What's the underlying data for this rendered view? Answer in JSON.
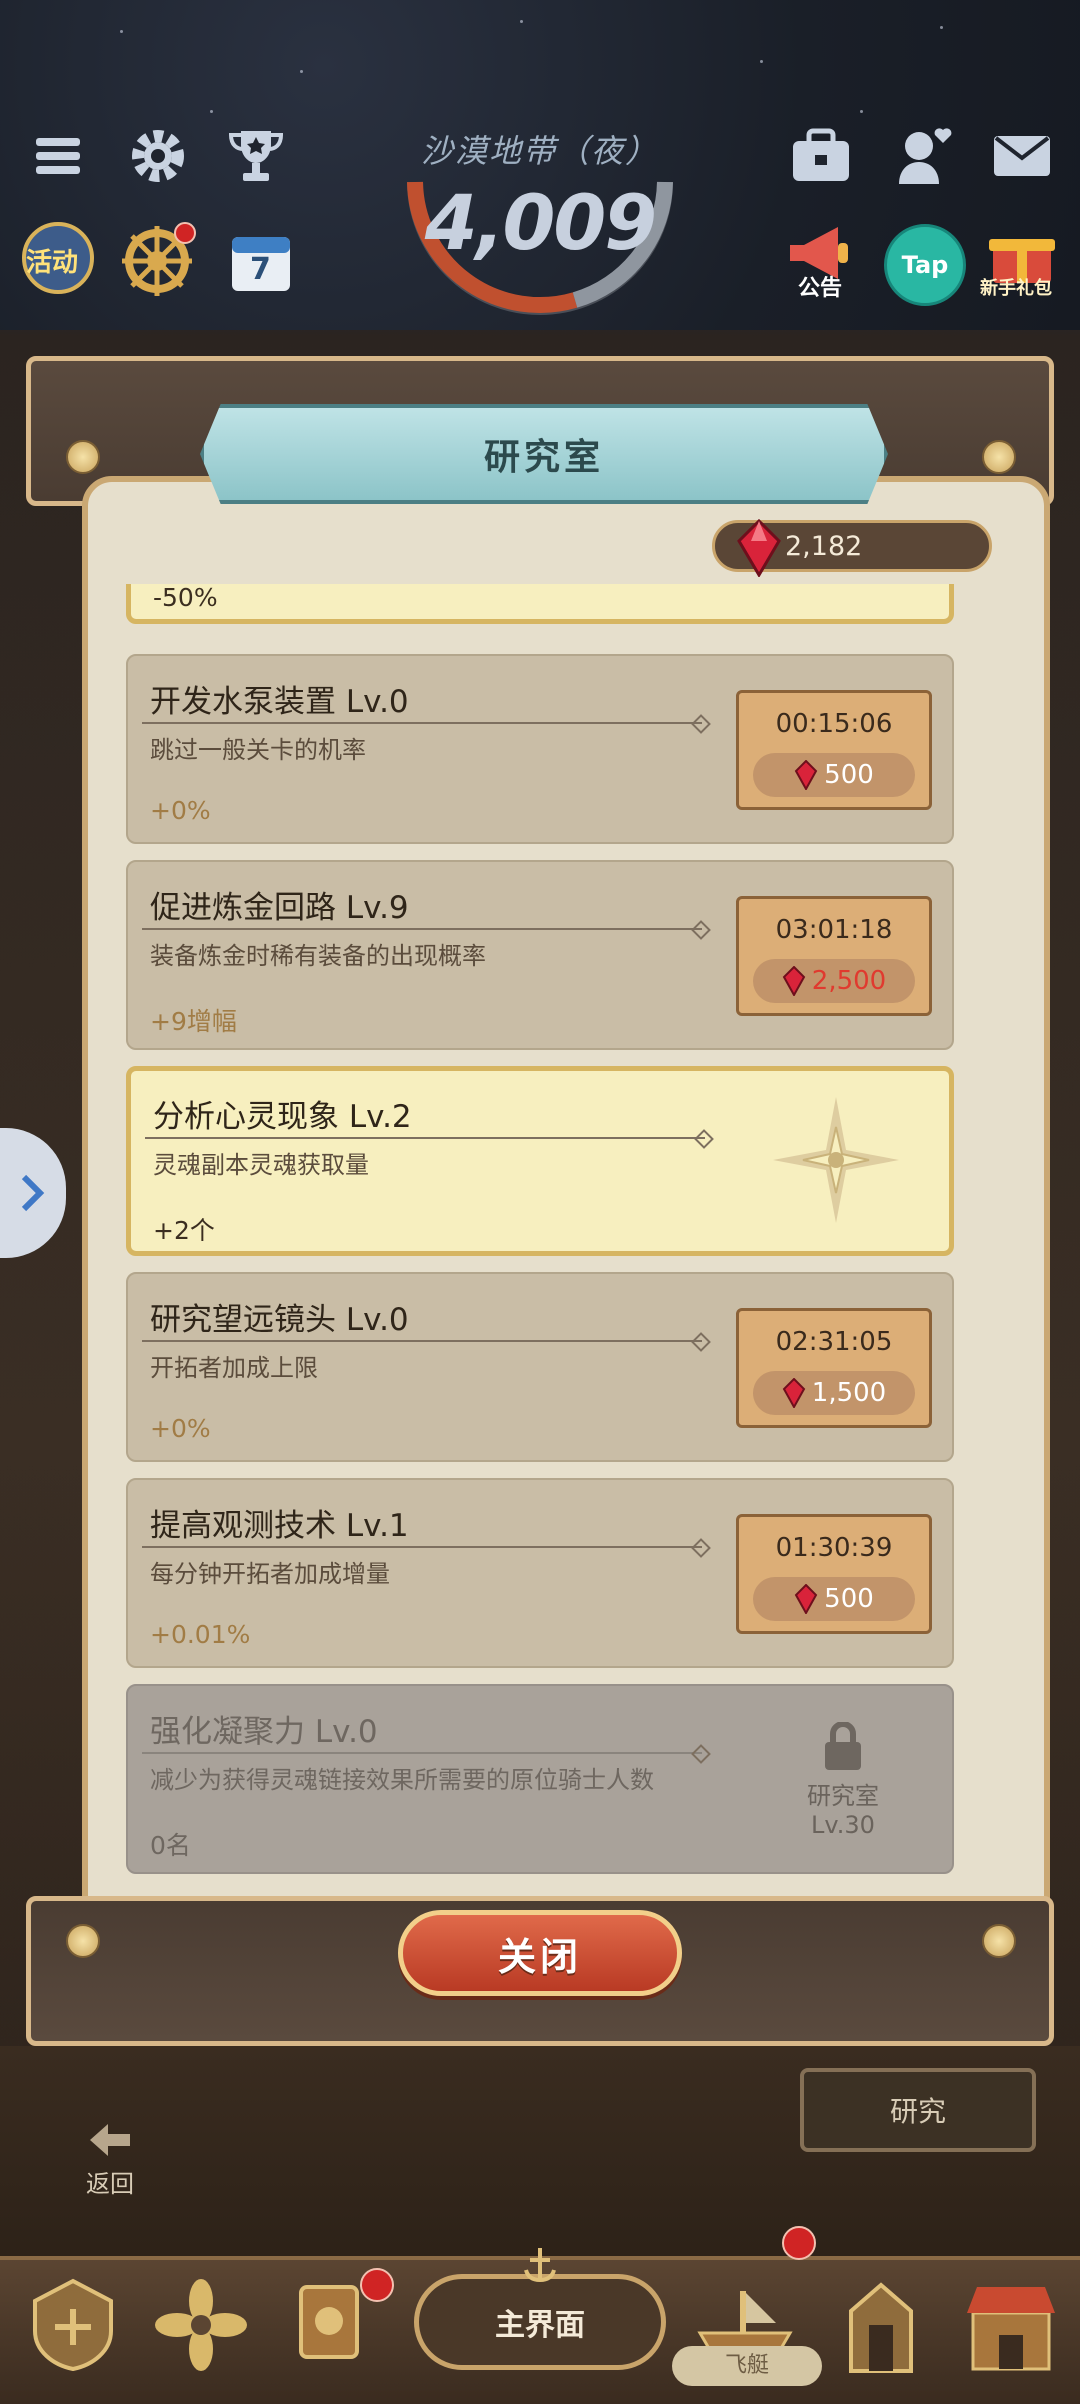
{
  "hud": {
    "area_name": "沙漠地带（夜）",
    "score": "4,009",
    "events_label": "活动",
    "calendar_day": "7",
    "notice_label": "公告",
    "tap_label": "Tap",
    "newbie_label": "新手礼包"
  },
  "panel": {
    "title": "研究室",
    "gem_amount": "2,182",
    "partial_item_effect": "-50%",
    "items": [
      {
        "name": "开发水泵装置 Lv.0",
        "desc": "跳过一般关卡的机率",
        "effect": "+0%",
        "timer": "00:15:06",
        "cost": "500",
        "cost_color": "#ffffff"
      },
      {
        "name": "促进炼金回路 Lv.9",
        "desc": "装备炼金时稀有装备的出现概率",
        "effect": "+9增幅",
        "timer": "03:01:18",
        "cost": "2,500",
        "cost_color": "#e03a2f"
      },
      {
        "name": "分析心灵现象 Lv.2",
        "desc": "灵魂副本灵魂获取量",
        "effect": "+2个"
      },
      {
        "name": "研究望远镜头 Lv.0",
        "desc": "开拓者加成上限",
        "effect": "+0%",
        "timer": "02:31:05",
        "cost": "1,500",
        "cost_color": "#ffffff"
      },
      {
        "name": "提高观测技术 Lv.1",
        "desc": "每分钟开拓者加成增量",
        "effect": "+0.01%",
        "timer": "01:30:39",
        "cost": "500",
        "cost_color": "#ffffff"
      },
      {
        "name": "强化凝聚力 Lv.0",
        "desc": "减少为获得灵魂链接效果所需要的原位骑士人数",
        "effect": "0名",
        "lock_line1": "研究室",
        "lock_line2": "Lv.30"
      }
    ],
    "close_label": "关闭"
  },
  "scene": {
    "research_label": "研究",
    "back_label": "返回"
  },
  "nav": {
    "main_label": "主界面",
    "ship_label": "飞艇"
  },
  "colors": {
    "accent_gold": "#c9a46a",
    "close_red": "#c94a30",
    "insufficient_cost": "#e03a2f"
  }
}
